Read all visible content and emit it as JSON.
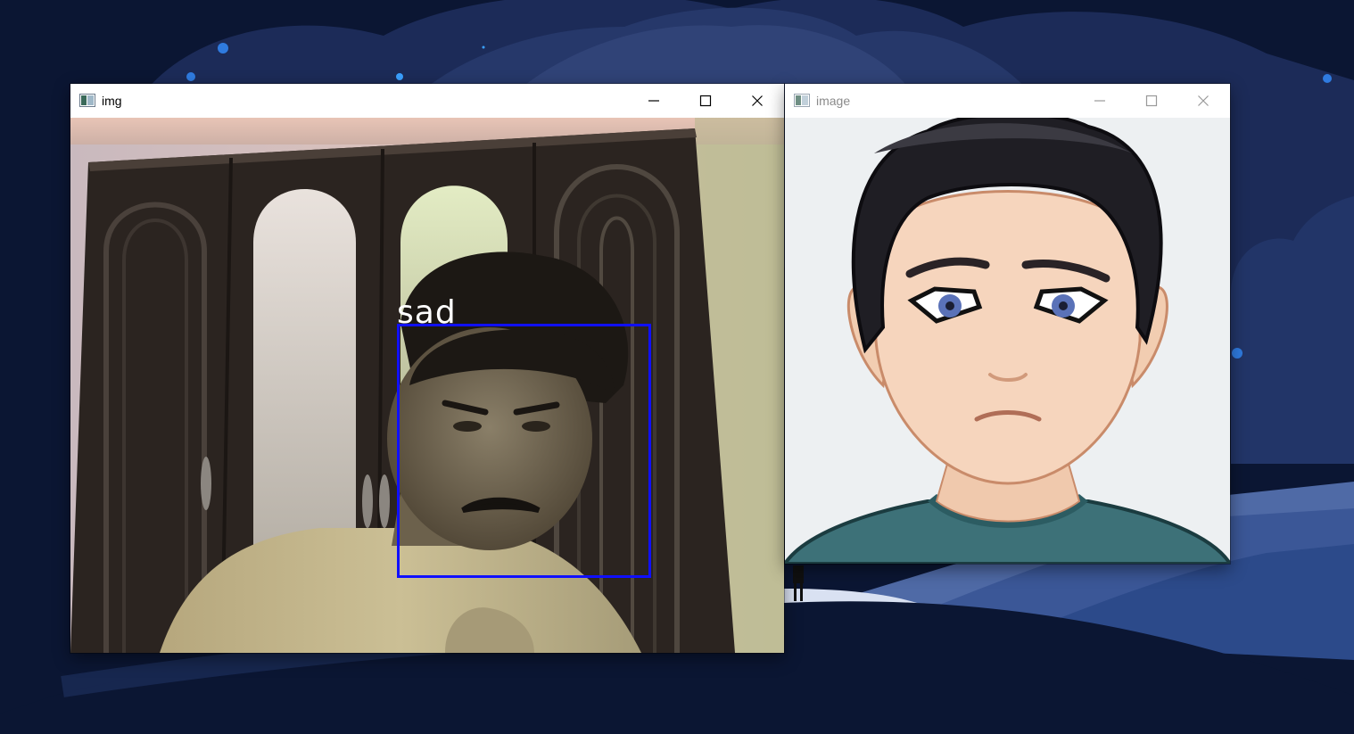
{
  "windows": {
    "camera": {
      "title": "img",
      "detection": {
        "label": "sad"
      }
    },
    "avatar": {
      "title": "image",
      "expression": "sad"
    }
  },
  "controls": {
    "minimize": "minimize-icon",
    "maximize": "maximize-icon",
    "close": "close-icon"
  },
  "colors": {
    "desktop_bg": "#0b1633",
    "detection_box": "#1010ff",
    "detection_text": "#ffffff"
  }
}
